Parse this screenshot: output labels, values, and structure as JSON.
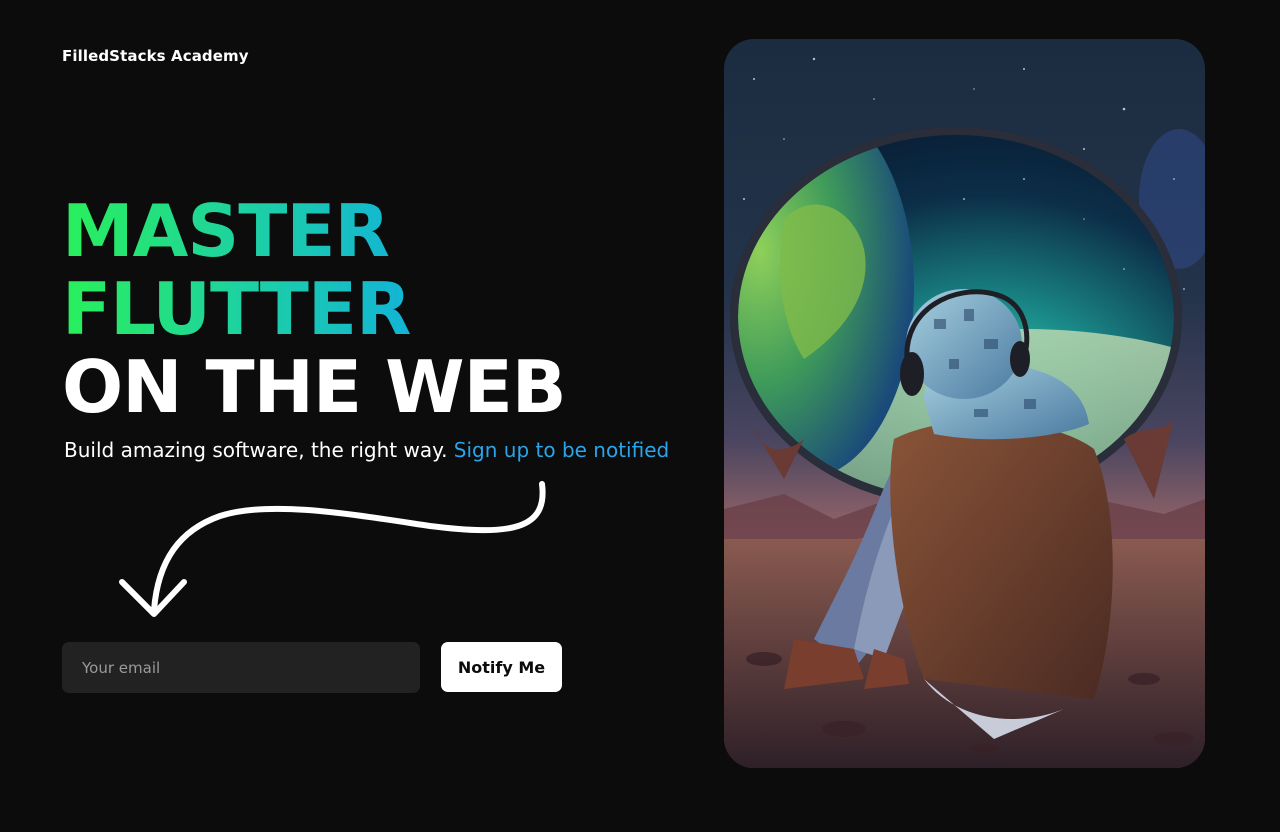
{
  "brand": {
    "name": "FilledStacks Academy"
  },
  "headline": {
    "line1": "MASTER",
    "line2": "FLUTTER",
    "line3": "ON THE WEB"
  },
  "subline": {
    "text": "Build amazing software, the right way.",
    "link_label": "Sign up to be notified"
  },
  "form": {
    "email_placeholder": "Your email",
    "email_value": "",
    "submit_label": "Notify Me"
  },
  "colors": {
    "background": "#0c0c0c",
    "gradient_start": "#29f05a",
    "gradient_end": "#1a8cf5",
    "link": "#2aa4ea",
    "input_bg": "#222222",
    "button_bg": "#ffffff"
  },
  "icons": {
    "arrow": "curved-arrow-down-icon"
  }
}
